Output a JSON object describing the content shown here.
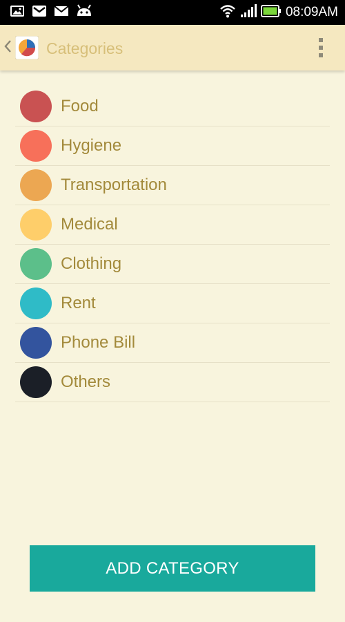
{
  "status_bar": {
    "time": "08:09AM",
    "left_icons": [
      "gallery-notification-icon",
      "gmail-notification-icon",
      "email-notification-icon",
      "android-debug-icon"
    ],
    "right_icons": [
      "wifi-icon",
      "signal-icon",
      "battery-icon"
    ],
    "battery_color": "#7ad63a"
  },
  "action_bar": {
    "title": "Categories",
    "icons": [
      "back-chevron-icon",
      "app-pie-chart-icon",
      "overflow-menu-icon"
    ]
  },
  "categories": [
    {
      "label": "Food",
      "color": "#c95252"
    },
    {
      "label": "Hygiene",
      "color": "#f7705a"
    },
    {
      "label": "Transportation",
      "color": "#eca752"
    },
    {
      "label": "Medical",
      "color": "#fece6a"
    },
    {
      "label": "Clothing",
      "color": "#5cbf8a"
    },
    {
      "label": "Rent",
      "color": "#2fbbc7"
    },
    {
      "label": "Phone Bill",
      "color": "#33549e"
    },
    {
      "label": "Others",
      "color": "#1b1f27"
    }
  ],
  "add_button": {
    "label": "ADD CATEGORY",
    "color": "#19a99c"
  }
}
